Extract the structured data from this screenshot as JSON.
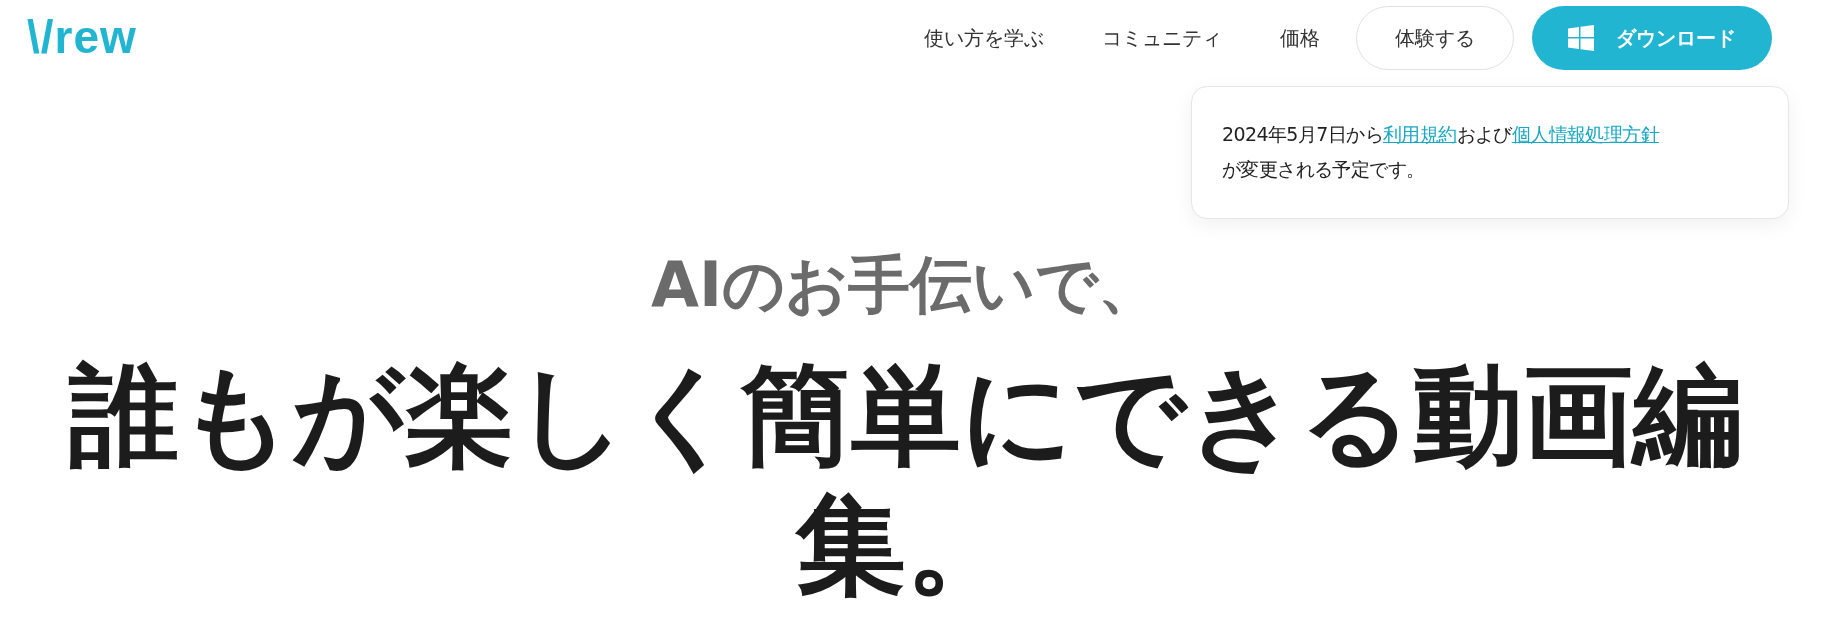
{
  "header": {
    "logo": "\\/rew",
    "nav": [
      {
        "label": "使い方を学ぶ",
        "kind": "link"
      },
      {
        "label": "コミュニティ",
        "kind": "link"
      },
      {
        "label": "価格",
        "kind": "link"
      },
      {
        "label": "体験する",
        "kind": "outline"
      },
      {
        "label": "ダウンロード",
        "kind": "primary"
      }
    ]
  },
  "notice": {
    "parts": [
      {
        "text": "2024年5月7日から",
        "kind": "text"
      },
      {
        "text": "利用規約",
        "kind": "link"
      },
      {
        "text": "および",
        "kind": "text"
      },
      {
        "text": "個人情報処理方針",
        "kind": "link"
      },
      {
        "text": "が変更される予定です。",
        "kind": "text"
      }
    ]
  },
  "hero": {
    "subtitle": "AIのお手伝いで、",
    "title": "誰もが楽しく簡単にできる動画編集。"
  }
}
